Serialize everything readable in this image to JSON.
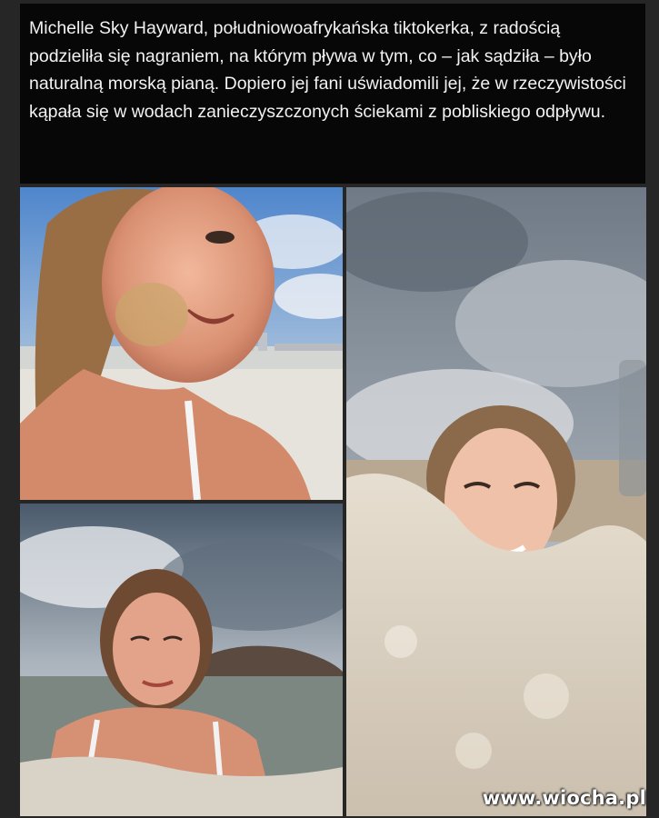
{
  "caption": {
    "text": "Michelle Sky Hayward, południowoafrykańska tiktokerka, z radością podzieliła się nagraniem, na którym pływa w tym, co – jak sądziła – było naturalną morską pianą. Dopiero jej fani uświadomili jej, że w rzeczywistości kąpała się w wodach zanieczyszczonych ściekami z pobliskiego odpływu."
  },
  "watermark": {
    "text": "www.wiocha.pl"
  },
  "photos": [
    {
      "subject": "woman-selfie-beach-sand-on-face"
    },
    {
      "subject": "woman-head-in-foam-cloudy-sky"
    },
    {
      "subject": "woman-in-foamy-sea-rocks"
    }
  ]
}
